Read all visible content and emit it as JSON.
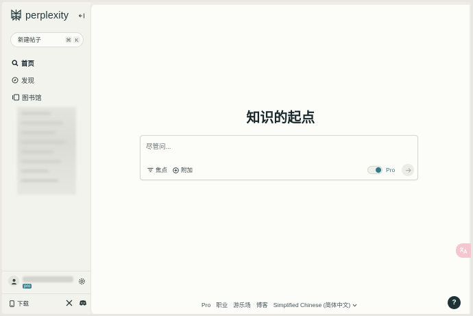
{
  "app": {
    "brand": "perplexity"
  },
  "sidebar": {
    "new_thread": {
      "label": "新建帖子",
      "shortcut_keys": [
        "⌘",
        "K"
      ]
    },
    "nav": [
      {
        "label": "首页",
        "icon": "search-icon",
        "active": true
      },
      {
        "label": "发现",
        "icon": "compass-icon",
        "active": false
      },
      {
        "label": "图书馆",
        "icon": "library-icon",
        "active": false
      }
    ],
    "account": {
      "badge": "pro"
    },
    "download_label": "下载"
  },
  "main": {
    "title": "知识的起点",
    "search": {
      "placeholder": "尽管问...",
      "value": ""
    },
    "tools": {
      "focus_label": "焦点",
      "attach_label": "附加"
    },
    "pro": {
      "label": "Pro",
      "enabled": true
    }
  },
  "footer": {
    "links": [
      "Pro",
      "职业",
      "游乐场",
      "博客"
    ],
    "language": "Simplified Chinese (简体中文)"
  },
  "help_label": "?",
  "colors": {
    "accent": "#2f7b89",
    "sidebar_bg": "#f3f3ee",
    "main_bg": "#fcfcf9",
    "help_bg": "#1e3338"
  }
}
